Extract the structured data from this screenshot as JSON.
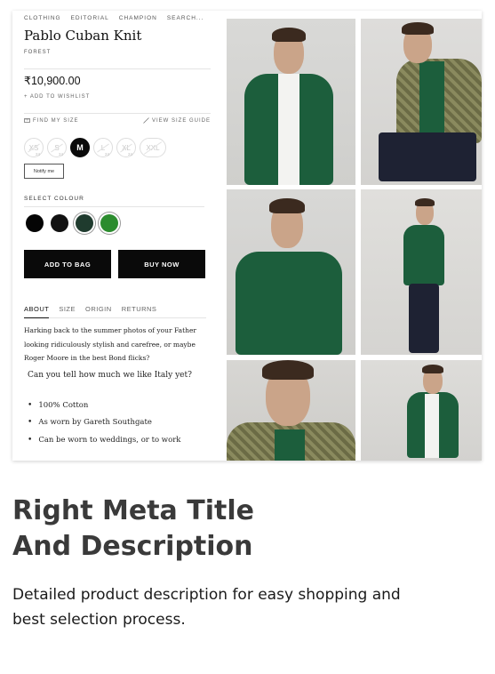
{
  "breadcrumbs": [
    "CLOTHING",
    "EDITORIAL",
    "CHAMPION",
    "SEARCH..."
  ],
  "product": {
    "title": "Pablo Cuban Knit",
    "color_name": "FOREST",
    "price": "₹10,900.00",
    "wishlist_label": "+ ADD TO WISHLIST",
    "find_size_label": "FIND MY SIZE",
    "size_guide_label": "VIEW SIZE GUIDE"
  },
  "sizes": [
    {
      "label": "XS",
      "count": "24",
      "available": false
    },
    {
      "label": "S",
      "count": "24",
      "available": false
    },
    {
      "label": "M",
      "count": "",
      "available": true,
      "selected": true
    },
    {
      "label": "L",
      "count": "24",
      "available": false
    },
    {
      "label": "XL",
      "count": "24",
      "available": false
    },
    {
      "label": "XXL",
      "count": "",
      "available": false
    }
  ],
  "notify_label": "Notify me",
  "colour": {
    "label": "SELECT COLOUR",
    "swatches": [
      {
        "name": "black",
        "hex": "#050505"
      },
      {
        "name": "dark",
        "hex": "#111111"
      },
      {
        "name": "forest",
        "hex": "#1f3b2e",
        "selected": true
      },
      {
        "name": "green",
        "hex": "#2b8c2e",
        "selected": true
      }
    ]
  },
  "actions": {
    "add_to_bag": "ADD TO BAG",
    "buy_now": "BUY NOW"
  },
  "tabs": [
    {
      "label": "ABOUT",
      "active": true
    },
    {
      "label": "SIZE",
      "active": false
    },
    {
      "label": "ORIGIN",
      "active": false
    },
    {
      "label": "RETURNS",
      "active": false
    }
  ],
  "description": {
    "lines": [
      "Harking back to the summer photos of your Father",
      "looking ridiculously stylish and carefree, or maybe",
      "Roger Moore in the best Bond flicks?"
    ],
    "question": "Can you tell how much we like Italy yet?",
    "bullets": [
      "100% Cotton",
      "As worn by Gareth Southgate",
      "Can be worn to weddings, or to work"
    ]
  },
  "photos": [
    {
      "name": "model-front-open-shirt",
      "shirt": "#1c5e3c"
    },
    {
      "name": "model-seated-check-jacket",
      "shirt": "#1c5e3c"
    },
    {
      "name": "model-closeup-buttoned",
      "shirt": "#1c5e3c"
    },
    {
      "name": "model-full-length",
      "shirt": "#1c5e3c"
    },
    {
      "name": "model-face-closeup",
      "shirt": "#1c5e3c"
    },
    {
      "name": "model-full-open-shirt",
      "shirt": "#1c5e3c"
    }
  ],
  "promo": {
    "title_line1": "Right Meta Title",
    "title_line2": "And Description",
    "text_line1": "Detailed product description for easy shopping and",
    "text_line2": "best selection process."
  }
}
